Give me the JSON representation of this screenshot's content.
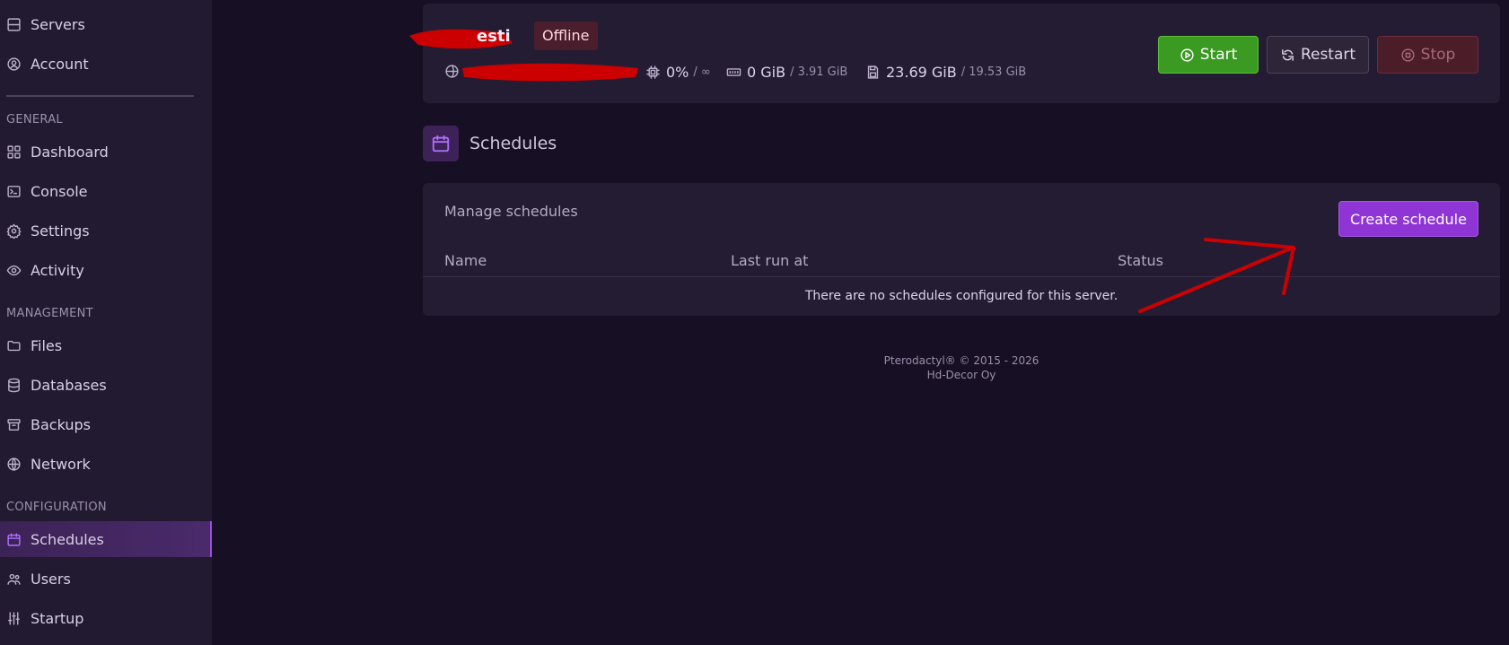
{
  "sidebar": {
    "top_items": [
      {
        "label": "Servers",
        "icon": "server-icon"
      },
      {
        "label": "Account",
        "icon": "user-circle-icon"
      }
    ],
    "sections": [
      {
        "title": "GENERAL",
        "items": [
          {
            "label": "Dashboard",
            "icon": "grid-icon"
          },
          {
            "label": "Console",
            "icon": "terminal-icon"
          },
          {
            "label": "Settings",
            "icon": "gear-icon"
          },
          {
            "label": "Activity",
            "icon": "eye-icon"
          }
        ]
      },
      {
        "title": "MANAGEMENT",
        "items": [
          {
            "label": "Files",
            "icon": "folder-icon"
          },
          {
            "label": "Databases",
            "icon": "database-icon"
          },
          {
            "label": "Backups",
            "icon": "archive-icon"
          },
          {
            "label": "Network",
            "icon": "globe-icon"
          }
        ]
      },
      {
        "title": "CONFIGURATION",
        "items": [
          {
            "label": "Schedules",
            "icon": "calendar-icon",
            "active": true
          },
          {
            "label": "Users",
            "icon": "users-icon"
          },
          {
            "label": "Startup",
            "icon": "sliders-icon"
          }
        ]
      }
    ]
  },
  "server": {
    "name_visible": "esti",
    "status": "Offline",
    "cpu": "0%",
    "cpu_limit": "/ ∞",
    "memory": "0 GiB",
    "memory_limit": "/ 3.91 GiB",
    "disk": "23.69 GiB",
    "disk_limit": "/ 19.53 GiB"
  },
  "power": {
    "start": "Start",
    "restart": "Restart",
    "stop": "Stop"
  },
  "page": {
    "title": "Schedules"
  },
  "schedules": {
    "manage_label": "Manage schedules",
    "create_button": "Create schedule",
    "columns": [
      "Name",
      "Last run at",
      "Status"
    ],
    "empty_message": "There are no schedules configured for this server."
  },
  "footer": {
    "line1": "Pterodactyl® © 2015 - 2026",
    "line2": "Hd-Decor Oy"
  },
  "colors": {
    "background": "#170f24",
    "sidebar": "#221a31",
    "accent": "#8f34d5",
    "start": "#3a9a22",
    "offline_badge": "#4a1e2c",
    "annotation": "#cc0000"
  }
}
